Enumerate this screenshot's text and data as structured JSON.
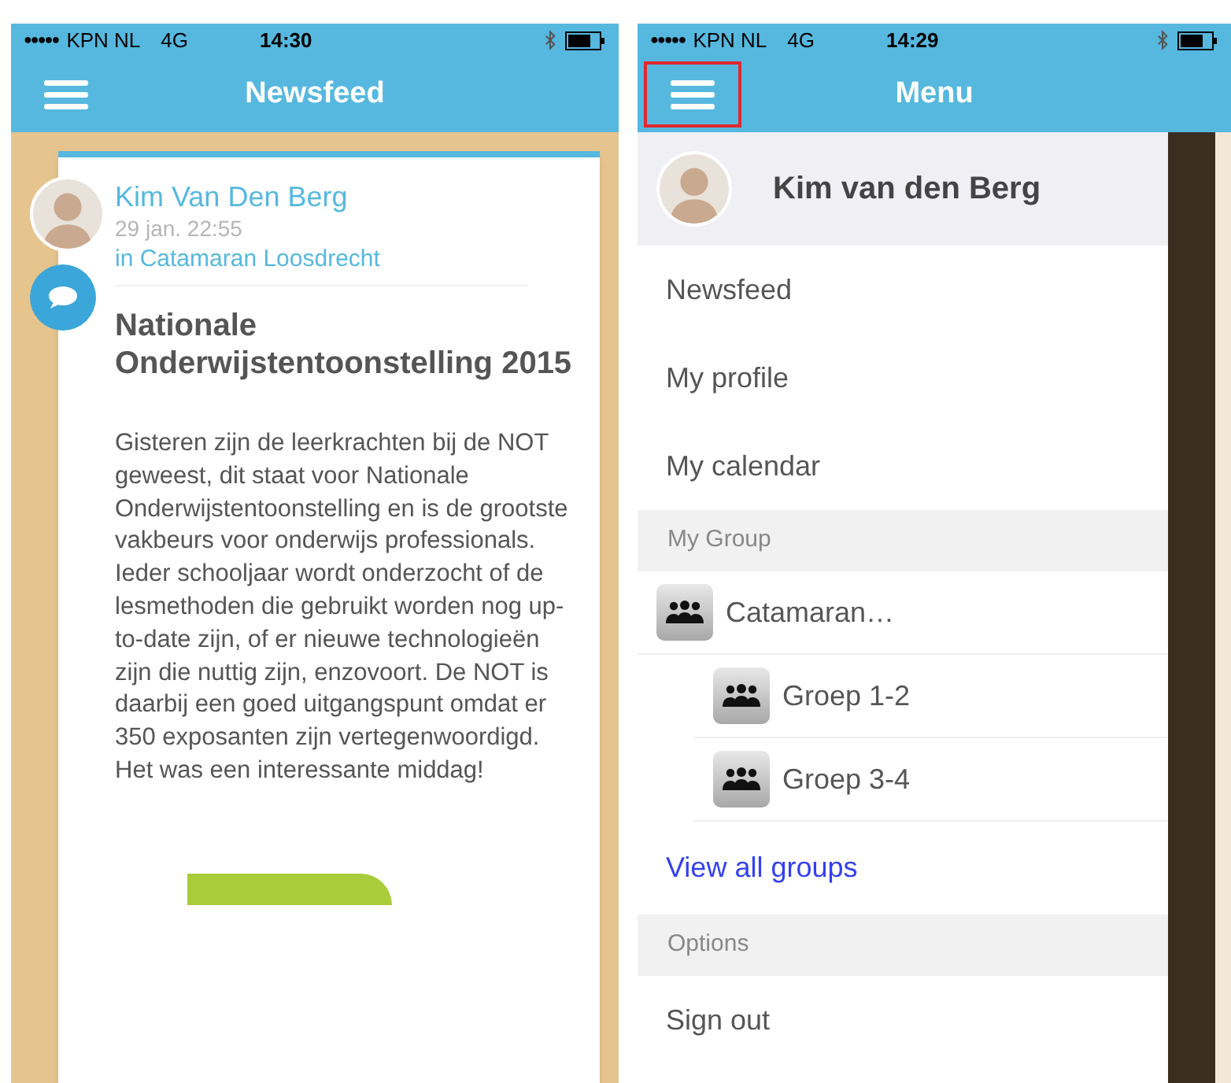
{
  "newsfeed_screen": {
    "status_bar": {
      "signal": "●●●●●",
      "carrier": "KPN NL",
      "network": "4G",
      "time": "14:30"
    },
    "nav_bar": {
      "title": "Newsfeed",
      "menu_highlighted": false
    },
    "post": {
      "author": "Kim Van Den Berg",
      "date": "29 jan. 22:55",
      "group": "in Catamaran Loosdrecht",
      "title": "Nationale Onderwijstentoonstelling 2015",
      "body": "Gisteren zijn de leerkrachten bij de NOT geweest, dit staat voor Nationale Onderwijstentoonstelling en is de grootste vakbeurs voor onderwijs professionals. Ieder schooljaar wordt onderzocht of de lesmethoden die gebruikt worden nog up-to-date zijn, of er nieuwe technologieën zijn die nuttig zijn, enzovoort. De NOT is daarbij een goed uitgangspunt omdat er 350 exposanten zijn vertegenwoordigd. Het was een interessante middag!"
    }
  },
  "menu_screen": {
    "status_bar": {
      "signal": "●●●●●",
      "carrier": "KPN NL",
      "network": "4G",
      "time": "14:29"
    },
    "nav_bar": {
      "title": "Menu",
      "menu_highlighted": true
    },
    "profile": {
      "name": "Kim van den Berg"
    },
    "items": [
      {
        "kind": "link",
        "label": "Newsfeed"
      },
      {
        "kind": "link",
        "label": "My profile"
      },
      {
        "kind": "link",
        "label": "My calendar"
      },
      {
        "kind": "header",
        "label": "My Group"
      },
      {
        "kind": "group",
        "label": "Catamaran…",
        "children": [
          {
            "kind": "group",
            "label": "Groep 1-2"
          },
          {
            "kind": "group",
            "label": "Groep 3-4"
          }
        ]
      },
      {
        "kind": "action",
        "label": "View all groups"
      },
      {
        "kind": "header",
        "label": "Options"
      },
      {
        "kind": "link",
        "label": "Sign out"
      }
    ]
  }
}
